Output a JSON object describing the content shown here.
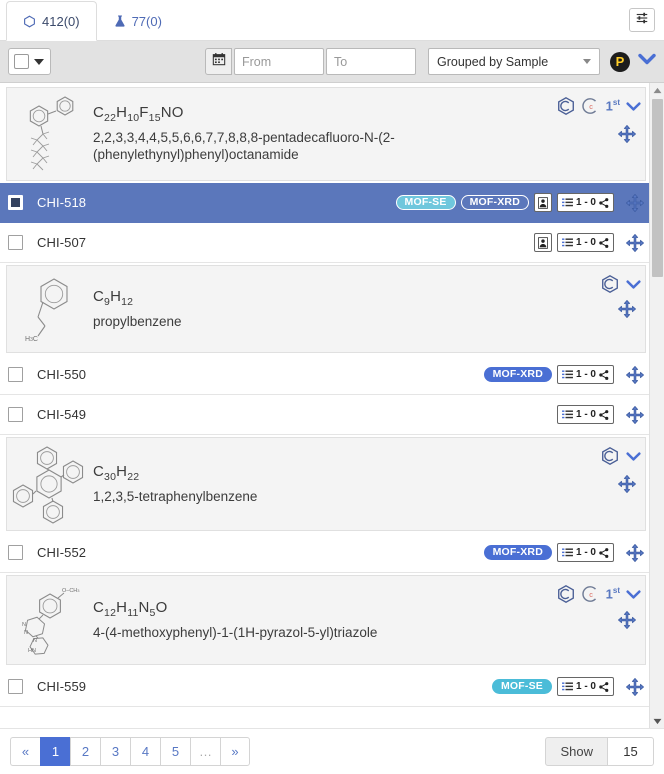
{
  "tabs": [
    {
      "label": "412(0)",
      "icon": "hexagon-structure-icon",
      "active": true,
      "name": "tab-structures"
    },
    {
      "label": "77(0)",
      "icon": "flask-sample-icon",
      "active": false,
      "name": "tab-samples"
    }
  ],
  "toolbar": {
    "filter_settings_icon": "sliders-icon",
    "select_all_checkbox": "",
    "calendar_icon": "calendar-icon",
    "from_placeholder": "From",
    "from_value": "",
    "to_placeholder": "To",
    "to_value": "",
    "group_select_value": "Grouped by Sample",
    "group_select_options": [
      "Grouped by Sample"
    ],
    "p_badge_label": "P",
    "expand_chevron_icon": "chevron-down-icon"
  },
  "colors": {
    "accent_blue": "#4a6fd4",
    "selected_row": "#5b77bb",
    "pill_se": "#4bbcd8",
    "pill_xrd": "#4a6fd4",
    "struct_row_bg": "#f4f4f4",
    "toolbar_bg": "#e2e2e2"
  },
  "rows": [
    {
      "type": "structure",
      "formula_html": "C<sub>22</sub>H<sub>10</sub>F<sub>15</sub>NO",
      "name": "2,2,3,3,4,4,5,5,6,6,7,7,8,8,8-pentadecafluoro-N-(2-(phenylethynyl)phenyl)octanamide",
      "icons": [
        "hexagon-c-icon",
        "copyright-c-icon",
        "first-badge"
      ],
      "first_label": "1",
      "first_suffix": "st",
      "structure": "pentadecafluoro-octanamide"
    },
    {
      "type": "sample",
      "id": "CHI-518",
      "selected": true,
      "checked": true,
      "pills": [
        {
          "label": "MOF-SE",
          "kind": "se"
        },
        {
          "label": "MOF-XRD",
          "kind": "xrd"
        }
      ],
      "has_user_btn": true,
      "count_label": "1 - 0"
    },
    {
      "type": "sample",
      "id": "CHI-507",
      "selected": false,
      "checked": false,
      "pills": [],
      "has_user_btn": true,
      "count_label": "1 - 0"
    },
    {
      "type": "structure",
      "formula_html": "C<sub>9</sub>H<sub>12</sub>",
      "name": "propylbenzene",
      "icons": [
        "hexagon-c-icon"
      ],
      "first_label": "",
      "first_suffix": "",
      "structure": "propylbenzene"
    },
    {
      "type": "sample",
      "id": "CHI-550",
      "selected": false,
      "checked": false,
      "pills": [
        {
          "label": "MOF-XRD",
          "kind": "xrd"
        }
      ],
      "has_user_btn": false,
      "count_label": "1 - 0"
    },
    {
      "type": "sample",
      "id": "CHI-549",
      "selected": false,
      "checked": false,
      "pills": [],
      "has_user_btn": false,
      "count_label": "1 - 0"
    },
    {
      "type": "structure",
      "formula_html": "C<sub>30</sub>H<sub>22</sub>",
      "name": "1,2,3,5-tetraphenylbenzene",
      "icons": [
        "hexagon-c-icon"
      ],
      "first_label": "",
      "first_suffix": "",
      "structure": "tetraphenylbenzene"
    },
    {
      "type": "sample",
      "id": "CHI-552",
      "selected": false,
      "checked": false,
      "pills": [
        {
          "label": "MOF-XRD",
          "kind": "xrd"
        }
      ],
      "has_user_btn": false,
      "count_label": "1 - 0"
    },
    {
      "type": "structure",
      "formula_html": "C<sub>12</sub>H<sub>11</sub>N<sub>5</sub>O",
      "name": "4-(4-methoxyphenyl)-1-(1H-pyrazol-5-yl)triazole",
      "icons": [
        "hexagon-c-icon",
        "copyright-c-icon",
        "first-badge"
      ],
      "first_label": "1",
      "first_suffix": "st",
      "structure": "methoxyphenyl-pyrazolyl-triazole"
    },
    {
      "type": "sample",
      "id": "CHI-559",
      "selected": false,
      "checked": false,
      "pills": [
        {
          "label": "MOF-SE",
          "kind": "se"
        }
      ],
      "has_user_btn": false,
      "count_label": "1 - 0"
    }
  ],
  "pager": {
    "prev_label": "«",
    "next_label": "»",
    "pages": [
      "1",
      "2",
      "3",
      "4",
      "5",
      "…"
    ],
    "active_page": "1",
    "show_label": "Show",
    "show_value": "15"
  }
}
